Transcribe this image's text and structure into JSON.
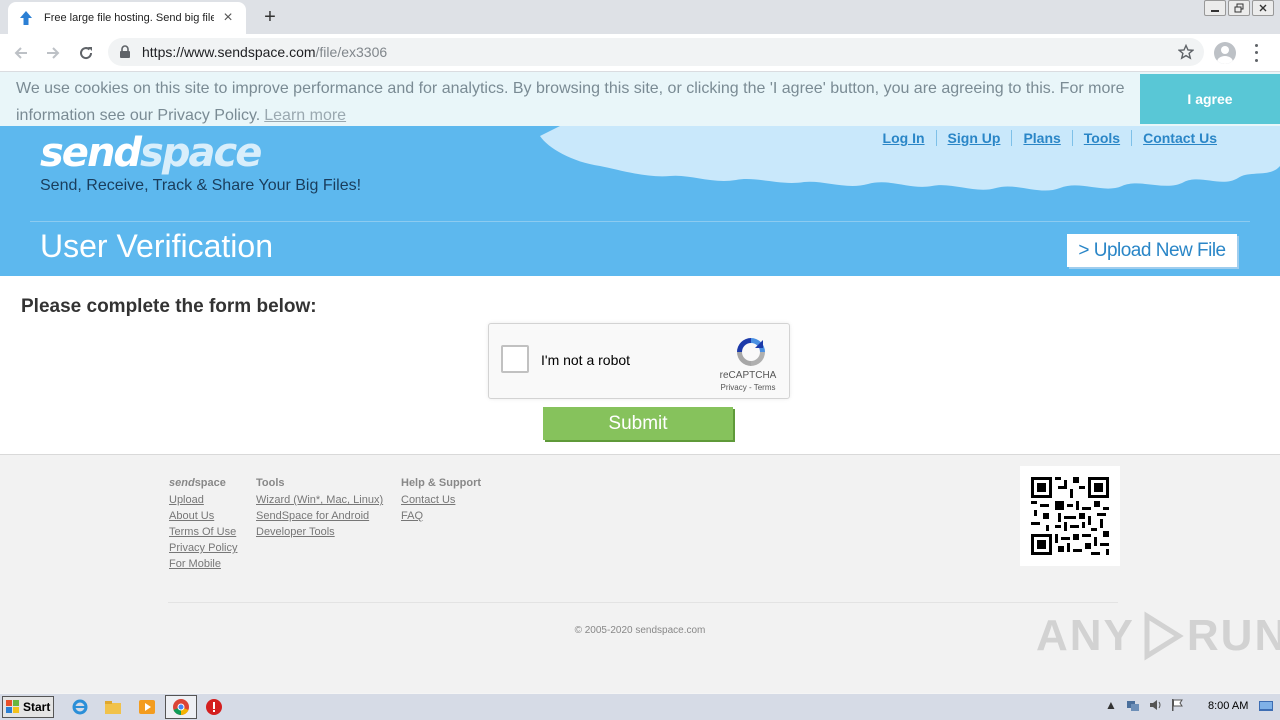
{
  "browser": {
    "tab_title": "Free large file hosting. Send big files",
    "url_prefix": "https://www.sendspace.com",
    "url_path": "/file/ex3306"
  },
  "cookie_bar": {
    "text": "We use cookies on this site to improve performance and for analytics. By browsing this site, or clicking the 'I agree' button, you are agreeing to this. For more information see our Privacy Policy.",
    "learn_more": "Learn more",
    "agree": "I agree"
  },
  "header": {
    "logo_bold": "send",
    "logo_rest": "space",
    "tagline": "Send, Receive, Track & Share Your Big Files!",
    "nav": [
      "Log In",
      "Sign Up",
      "Plans",
      "Tools",
      "Contact Us"
    ],
    "page_title": "User Verification",
    "upload_button": "> Upload New File"
  },
  "main": {
    "heading": "Please complete the form below:",
    "recaptcha": {
      "label": "I'm not a robot",
      "brand": "reCAPTCHA",
      "links": "Privacy - Terms"
    },
    "submit": "Submit"
  },
  "footer": {
    "col1": {
      "head_italic": "send",
      "head_rest": "space",
      "links": [
        "Upload",
        "About Us",
        "Terms Of Use",
        "Privacy Policy",
        "For Mobile"
      ]
    },
    "col2": {
      "head": "Tools",
      "links": [
        "Wizard (Win*, Mac, Linux)",
        "SendSpace for Android",
        "Developer Tools"
      ]
    },
    "col3": {
      "head": "Help & Support",
      "links": [
        "Contact Us",
        "FAQ"
      ]
    },
    "copyright": "© 2005-2020 sendspace.com",
    "watermark_left": "ANY",
    "watermark_right": "RUN"
  },
  "taskbar": {
    "start": "Start",
    "clock": "8:00 AM"
  },
  "colors": {
    "header_blue": "#5db8ee",
    "link_blue": "#2a86c7",
    "agree_teal": "#59c7d6",
    "submit_green": "#86c25c"
  }
}
